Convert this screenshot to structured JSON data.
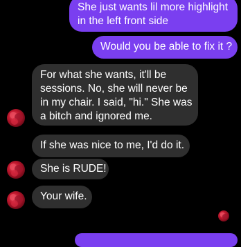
{
  "messages": [
    {
      "direction": "outgoing",
      "lines": [
        "She just wants lil more highlight",
        "in the left front side"
      ]
    },
    {
      "direction": "outgoing",
      "lines": [
        "Would you be able to fix it ?"
      ]
    },
    {
      "direction": "incoming",
      "lines": [
        "For what she wants, it'll be",
        "sessions. No, she will never be",
        "in my chair. I said, \"hi.\" She was",
        "a bitch and ignored me."
      ]
    },
    {
      "direction": "incoming",
      "lines": [
        "If she was nice to me, I'd do it."
      ]
    },
    {
      "direction": "incoming",
      "lines": [
        "She is RUDE!"
      ]
    },
    {
      "direction": "incoming",
      "lines": [
        "Your wife."
      ]
    }
  ],
  "colors": {
    "background": "#000000",
    "outgoing_bubble": "#7a3ff0",
    "incoming_bubble": "#2f2f2f",
    "text": "#ffffff"
  },
  "icons": {
    "contact_avatar": "red-flower-avatar-icon",
    "read_receipt": "red-flower-read-receipt-icon"
  }
}
